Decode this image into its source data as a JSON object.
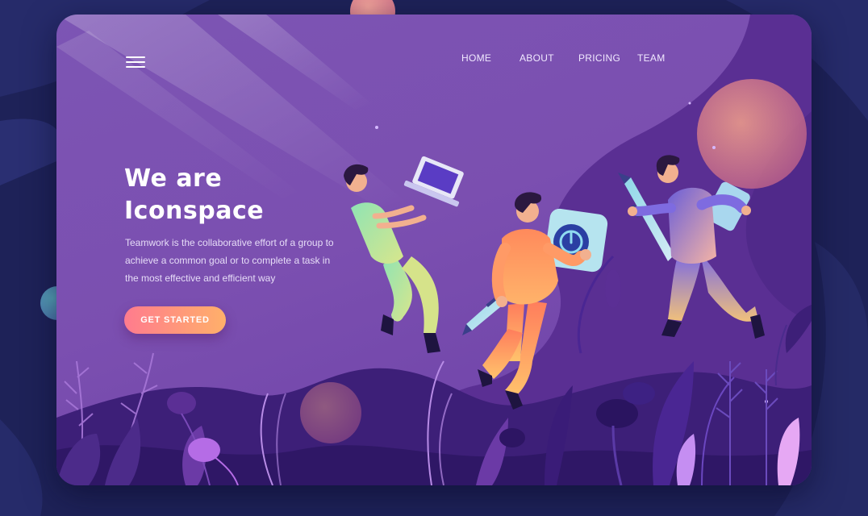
{
  "nav": {
    "items": [
      {
        "label": "HOME"
      },
      {
        "label": "ABOUT"
      },
      {
        "label": "PRICING"
      },
      {
        "label": "TEAM"
      }
    ]
  },
  "hero": {
    "title_line1": "We are",
    "title_line2": "Iconspace",
    "description": "Teamwork is the collaborative effort of a group to achieve a common goal or to complete a task in the most effective and efficient way",
    "cta_label": "GET STARTED"
  },
  "icons": {
    "menu": "hamburger-menu-icon",
    "power": "power-icon"
  },
  "colors": {
    "page_bg": "#1e2258",
    "card_bg": "#7b52b2",
    "cta_start": "#ff7b8e",
    "cta_end": "#ffb06a",
    "accent_planet": "#f29b8a"
  }
}
